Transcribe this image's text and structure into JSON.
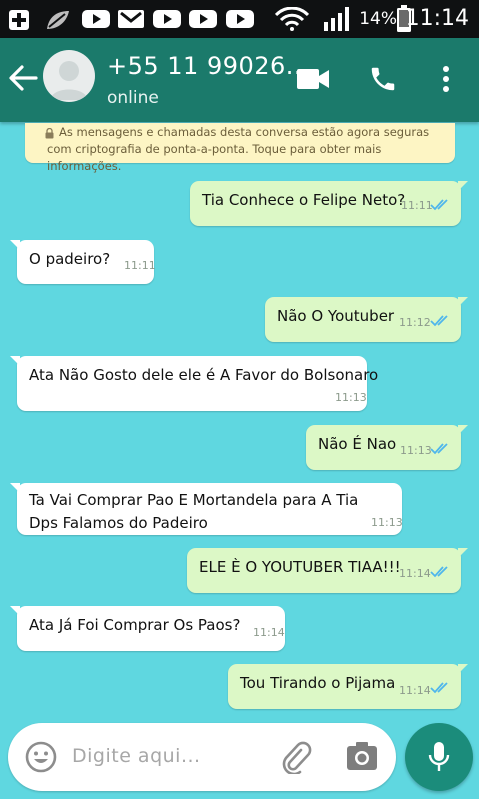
{
  "status_bar": {
    "battery_percent": "14%",
    "time": "11:14",
    "icons": [
      "add-box-icon",
      "leaf-icon",
      "youtube-icon",
      "gmail-icon",
      "youtube-icon",
      "youtube-icon",
      "youtube-icon",
      "wifi-icon",
      "signal-icon",
      "battery-icon"
    ]
  },
  "header": {
    "contact_name": "+55 11 99026...",
    "status": "online",
    "icons": [
      "back-arrow-icon",
      "avatar",
      "video-call-icon",
      "phone-icon",
      "more-vert-icon"
    ]
  },
  "chat": {
    "encryption_notice": "As mensagens e chamadas desta conversa estão agora seguras com criptografia de ponta-a-ponta. Toque para obter mais informações.",
    "messages": [
      {
        "direction": "out",
        "text": "Tia Conhece o Felipe Neto?",
        "time": "11:11",
        "status": "read"
      },
      {
        "direction": "in",
        "text": "O padeiro?",
        "time": "11:11"
      },
      {
        "direction": "out",
        "text": "Não O Youtuber",
        "time": "11:12",
        "status": "read"
      },
      {
        "direction": "in",
        "text": "Ata Não Gosto dele ele é A Favor do Bolsonaro",
        "time": "11:13"
      },
      {
        "direction": "out",
        "text": "Não É Nao",
        "time": "11:13",
        "status": "read"
      },
      {
        "direction": "in",
        "text": "Ta Vai Comprar Pao E Mortandela para A Tia Dps Falamos do Padeiro",
        "time": "11:13"
      },
      {
        "direction": "out",
        "text": "ELE È O YOUTUBER TIAA!!!",
        "time": "11:14",
        "status": "read"
      },
      {
        "direction": "in",
        "text": "Ata Já Foi Comprar Os Paos?",
        "time": "11:14"
      },
      {
        "direction": "out",
        "text": "Tou Tirando o Pijama",
        "time": "11:14",
        "status": "read"
      }
    ]
  },
  "composer": {
    "placeholder": "Digite aqui...",
    "icons": [
      "emoji-icon",
      "attach-icon",
      "camera-icon",
      "mic-icon"
    ]
  },
  "colors": {
    "header": "#1b7a6b",
    "wallpaper": "#5fd7e0",
    "outgoing_bubble": "#dcf8c6",
    "incoming_bubble": "#ffffff",
    "read_ticks": "#4fb6ec",
    "notice": "#fdf5c4"
  }
}
